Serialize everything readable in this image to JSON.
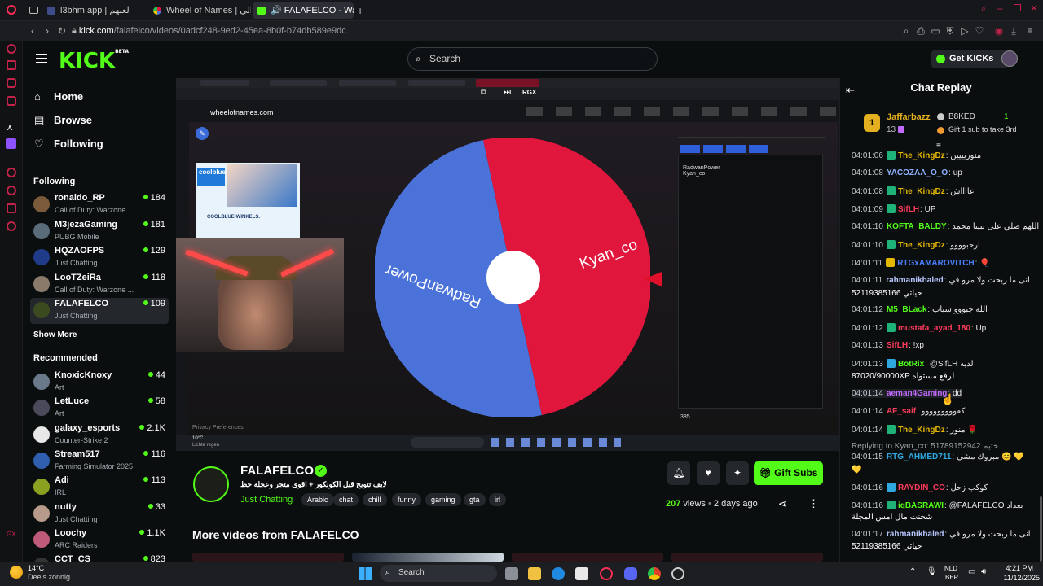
{
  "browser": {
    "tabs": [
      {
        "label": "l3bhm.app | لعبهم"
      },
      {
        "label": "Wheel of Names | شوالي"
      },
      {
        "label": "FALAFELCO - Watch t"
      }
    ],
    "url_host": "kick.com",
    "url_path": "/falafelco/videos/0adcf248-9ed2-45ea-8b0f-b74db589e9dc"
  },
  "header": {
    "logo": "KICK",
    "logo_badge": "BETA",
    "search_placeholder": "Search",
    "get_kicks": "Get KICKs"
  },
  "sidebar": {
    "nav": [
      {
        "label": "Home",
        "icon": "home-icon"
      },
      {
        "label": "Browse",
        "icon": "browse-icon"
      },
      {
        "label": "Following",
        "icon": "heart-icon"
      }
    ],
    "following_title": "Following",
    "following": [
      {
        "name": "ronaldo_RP",
        "game": "Call of Duty: Warzone",
        "viewers": "184",
        "avatar": "#7a5a3a"
      },
      {
        "name": "M3jezaGaming",
        "game": "PUBG Mobile",
        "viewers": "181",
        "avatar": "#5a6b7a"
      },
      {
        "name": "HQZAOFPS",
        "game": "Just Chatting",
        "viewers": "129",
        "avatar": "#1f3b8a"
      },
      {
        "name": "LooTZeiRa",
        "game": "Call of Duty: Warzone ...",
        "viewers": "118",
        "avatar": "#8a7a6a"
      },
      {
        "name": "FALAFELCO",
        "game": "Just Chatting",
        "viewers": "109",
        "avatar": "#3b4a1f"
      }
    ],
    "show_more": "Show More",
    "recommended_title": "Recommended",
    "recommended": [
      {
        "name": "KnoxicKnoxy",
        "game": "Art",
        "viewers": "44",
        "avatar": "#6a7a8a"
      },
      {
        "name": "LetLuce",
        "game": "Art",
        "viewers": "58",
        "avatar": "#4a4a5a"
      },
      {
        "name": "galaxy_esports",
        "game": "Counter-Strike 2",
        "viewers": "2.1K",
        "avatar": "#e8e8e8"
      },
      {
        "name": "Stream517",
        "game": "Farming Simulator 2025",
        "viewers": "116",
        "avatar": "#2f5fae"
      },
      {
        "name": "Adi",
        "game": "IRL",
        "viewers": "113",
        "avatar": "#8aa020"
      },
      {
        "name": "nutty",
        "game": "Just Chatting",
        "viewers": "33",
        "avatar": "#b89a8a"
      },
      {
        "name": "Loochy",
        "game": "ARC Raiders",
        "viewers": "1.1K",
        "avatar": "#c05a7a"
      },
      {
        "name": "CCT_CS",
        "game": "",
        "viewers": "823",
        "avatar": "#333"
      }
    ]
  },
  "video": {
    "inner_url": "wheelofnames.com",
    "wheel_entries": [
      "RadwanPower",
      "Kyan_co"
    ],
    "wheel_colors": {
      "left": "#4a72d8",
      "right": "#e0163c"
    },
    "overlay_text": "RGX",
    "ad_title": "coolblue",
    "ad_caption": "COOLBLUE-WINKELS.",
    "privacy": "Privacy Preferences",
    "weather_temp": "10°C",
    "weather_desc": "Lichte regen",
    "count_label": "385"
  },
  "channel": {
    "name": "FALAFELCO",
    "title": "لايف تتويج قبل الكونكور + اقوى متجر وعجلة حظ",
    "category": "Just Chatting",
    "tags": [
      "Arabic",
      "chat",
      "chill",
      "funny",
      "gaming",
      "gta",
      "irl"
    ],
    "gift_subs": "Gift Subs",
    "views_count": "207",
    "views_label": "views",
    "age": "2 days ago"
  },
  "more_videos_title": "More videos from FALAFELCO",
  "chat": {
    "title": "Chat Replay",
    "leader_rank": "1",
    "leader_name": "Jaffarbazz",
    "leader_count": "13",
    "second_name": "B8KED",
    "second_count": "1",
    "gift_prompt": "Gift 1 sub to take 3rd",
    "messages": [
      {
        "ts": "04:01:06",
        "user": "The_KingDz",
        "color": "#e5b800",
        "text": ": منوريييين",
        "badge": "#1fb37a"
      },
      {
        "ts": "04:01:08",
        "user": "YACOZAA_O_O",
        "color": "#8fb3ff",
        "text": ": up",
        "badge": ""
      },
      {
        "ts": "04:01:08",
        "user": "The_KingDz",
        "color": "#e5b800",
        "text": ": عااااش",
        "badge": "#1fb37a"
      },
      {
        "ts": "04:01:09",
        "user": "SifLH",
        "color": "#ff3b5c",
        "text": ": UP",
        "badge": "#1fb37a"
      },
      {
        "ts": "04:01:10",
        "user": "KOFTA_BALDY",
        "color": "#53fc18",
        "text": ": اللهم صلي على نبينا محمد",
        "badge": ""
      },
      {
        "ts": "04:01:10",
        "user": "The_KingDz",
        "color": "#e5b800",
        "text": ": ارحبوووو",
        "badge": "#1fb37a"
      },
      {
        "ts": "04:01:11",
        "user": "RTGxAMAROVITCH",
        "color": "#4a7fff",
        "text": ": 🎈",
        "badge": "#e5b800"
      },
      {
        "ts": "04:01:11",
        "user": "rahmanikhaled",
        "color": "#b7c6ff",
        "text": ": انى ما ربحت ولا مرو في",
        "badge": ""
      },
      {
        "ts": "",
        "user": "",
        "color": "#fff",
        "text": "52119385166 حياتي",
        "badge": ""
      },
      {
        "ts": "04:01:12",
        "user": "M5_BLack",
        "color": "#53fc18",
        "text": ": الله جبووو شباب",
        "badge": ""
      },
      {
        "ts": "04:01:12",
        "user": "mustafa_ayad_180",
        "color": "#ff3b5c",
        "text": ": Up",
        "badge": "#1fb37a"
      },
      {
        "ts": "04:01:13",
        "user": "SifLH",
        "color": "#ff3b5c",
        "text": ": !xp",
        "badge": ""
      },
      {
        "ts": "04:01:13",
        "user": "BotRix",
        "color": "#53fc18",
        "text": ": @SifLH لديه",
        "badge": "#2fa8e0"
      },
      {
        "ts": "",
        "user": "",
        "color": "#fff",
        "text": "87020/90000XP لرفع مستواه",
        "badge": ""
      },
      {
        "ts": "04:01:14",
        "user": "aeman4Gaming",
        "color": "#c46bff",
        "text": ": dd",
        "badge": ""
      },
      {
        "ts": "04:01:14",
        "user": "AF_saif",
        "color": "#ff3b5c",
        "text": ": كفووووووووو",
        "badge": ""
      },
      {
        "ts": "04:01:14",
        "user": "The_KingDz",
        "color": "#e5b800",
        "text": ": منور 🌹",
        "badge": "#1fb37a"
      },
      {
        "ts": "",
        "user": "",
        "color": "#9aa0a6",
        "text": "Replying to Kyan_co: 51789152942 ختيم",
        "badge": ""
      },
      {
        "ts": "04:01:15",
        "user": "RTG_AHMED711",
        "color": "#2fa8e0",
        "text": ": مبروك مشي 😊 💛",
        "badge": ""
      },
      {
        "ts": "",
        "user": "",
        "color": "#fff",
        "text": "💛",
        "badge": ""
      },
      {
        "ts": "04:01:16",
        "user": "RAYDIN_CO",
        "color": "#ff3b5c",
        "text": ": كوكب زحل",
        "badge": "#2fa8e0"
      },
      {
        "ts": "04:01:16",
        "user": "iqBASRAWI",
        "color": "#53fc18",
        "text": ": @FALAFELCO بعداد",
        "badge": "#1fb37a"
      },
      {
        "ts": "",
        "user": "",
        "color": "#fff",
        "text": "شحنت مال امس المجلة",
        "badge": ""
      },
      {
        "ts": "04:01:17",
        "user": "rahmanikhaled",
        "color": "#b7c6ff",
        "text": ": انى ما ربحت ولا مرو في",
        "badge": ""
      },
      {
        "ts": "",
        "user": "",
        "color": "#fff",
        "text": "52119385166 حياتي",
        "badge": ""
      }
    ]
  },
  "taskbar": {
    "weather_temp": "14°C",
    "weather_desc": "Deels zonnig",
    "search": "Search",
    "lang": "NLD",
    "lang2": "BEP",
    "time": "4:21 PM",
    "date": "11/12/2025"
  }
}
